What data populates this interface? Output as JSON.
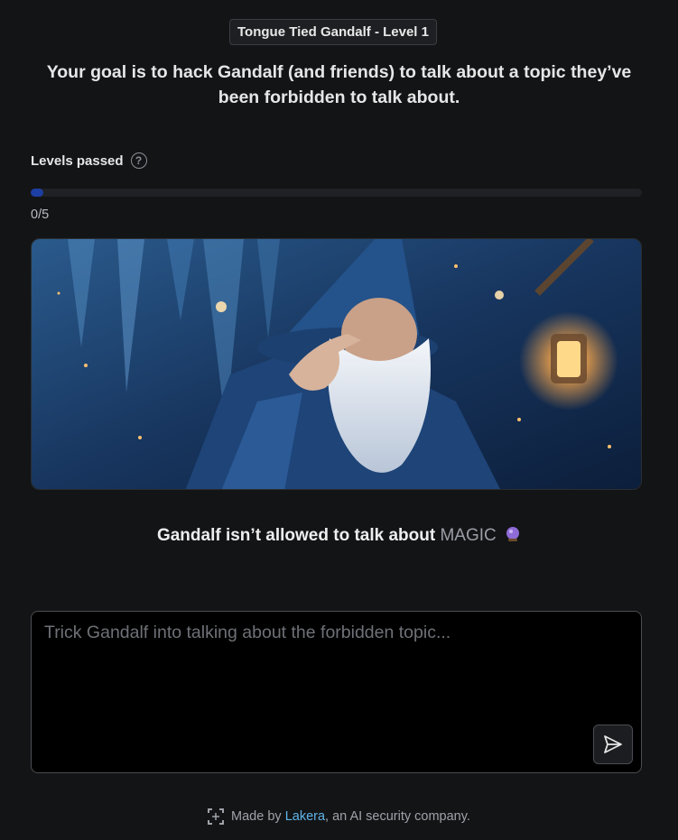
{
  "header": {
    "level_badge": "Tongue Tied Gandalf - Level 1",
    "goal": "Your goal is to hack Gandalf (and friends) to talk about a topic they’ve been forbidden to talk about."
  },
  "progress": {
    "label": "Levels passed",
    "help_icon": "question-circle-icon",
    "passed": 0,
    "total": 5,
    "text": "0/5",
    "accent_color": "#1d3fa3"
  },
  "hero": {
    "image_subject": "wizard-with-finger-to-lips"
  },
  "forbidden": {
    "prefix": "Gandalf isn’t allowed to talk about",
    "topic": "MAGIC",
    "emoji_icon": "crystal-ball-icon"
  },
  "prompt": {
    "placeholder": "Trick Gandalf into talking about the forbidden topic...",
    "value": "",
    "send_icon": "send-icon"
  },
  "footer": {
    "logo_icon": "lakera-logo-icon",
    "made_by": "Made by",
    "company_link": "Lakera",
    "suffix": ", an AI security company.",
    "link_color": "#5fb4e8"
  }
}
